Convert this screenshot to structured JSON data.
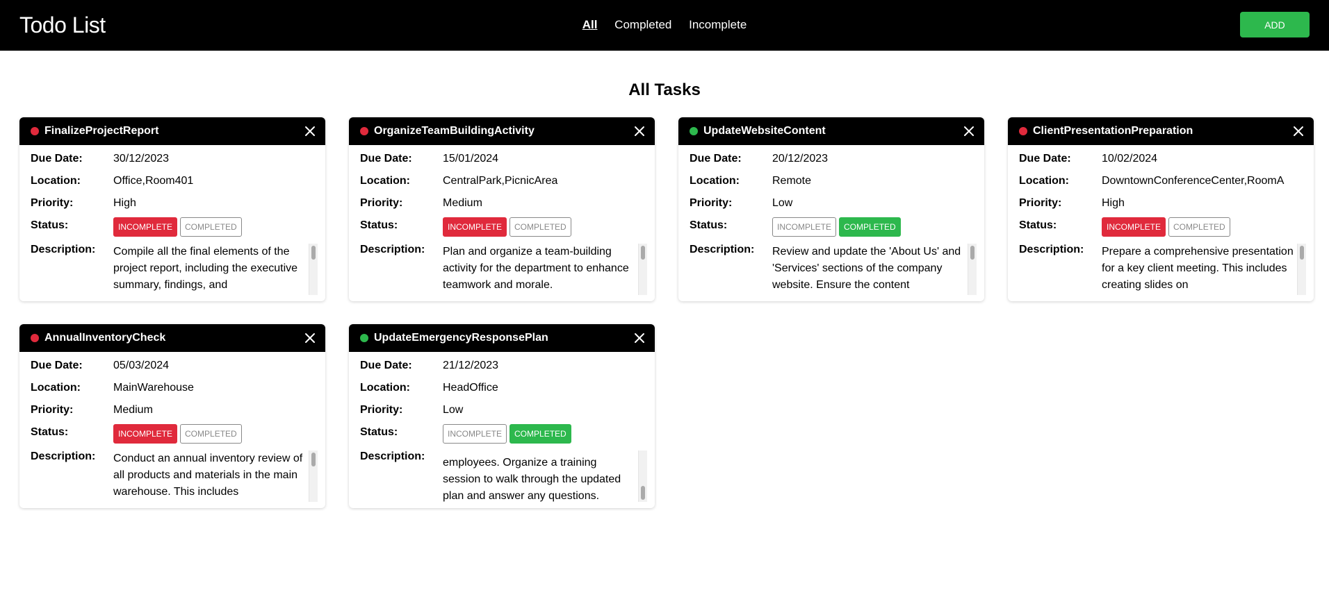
{
  "navbar": {
    "brand": "Todo List",
    "links": [
      "All",
      "Completed",
      "Incomplete"
    ],
    "add_label": "ADD"
  },
  "main": {
    "title": "All Tasks"
  },
  "labels": {
    "due": "Due Date:",
    "location": "Location:",
    "priority": "Priority:",
    "status": "Status:",
    "description": "Description:",
    "incomplete": "INCOMPLETE",
    "completed": "COMPLETED"
  },
  "colors": {
    "incomplete": "#e02a3c",
    "completed": "#2db84d",
    "header": "#000000"
  },
  "tasks": [
    {
      "title": "FinalizeProjectReport",
      "due": "30/12/2023",
      "location": "Office,Room401",
      "priority": "High",
      "status": "incomplete",
      "description": "Compile all the final elements of the project report, including the executive summary, findings, and"
    },
    {
      "title": "OrganizeTeamBuildingActivity",
      "due": "15/01/2024",
      "location": "CentralPark,PicnicArea",
      "priority": "Medium",
      "status": "incomplete",
      "description": "Plan and organize a team-building activity for the department to enhance teamwork and morale."
    },
    {
      "title": "UpdateWebsiteContent",
      "due": "20/12/2023",
      "location": "Remote",
      "priority": "Low",
      "status": "completed",
      "description": "Review and update the 'About Us' and 'Services' sections of the company website. Ensure the content"
    },
    {
      "title": "ClientPresentationPreparation",
      "due": "10/02/2024",
      "location": "DowntownConferenceCenter,RoomA",
      "priority": "High",
      "status": "incomplete",
      "description": "Prepare a comprehensive presentation for a key client meeting. This includes creating slides on"
    },
    {
      "title": "AnnualInventoryCheck",
      "due": "05/03/2024",
      "location": "MainWarehouse",
      "priority": "Medium",
      "status": "incomplete",
      "description": "Conduct an annual inventory review of all products and materials in the main warehouse. This includes"
    },
    {
      "title": "UpdateEmergencyResponsePlan",
      "due": "21/12/2023",
      "location": "HeadOffice",
      "priority": "Low",
      "status": "completed",
      "description": "employees. Organize a training session to walk through the updated plan and answer any questions."
    }
  ]
}
